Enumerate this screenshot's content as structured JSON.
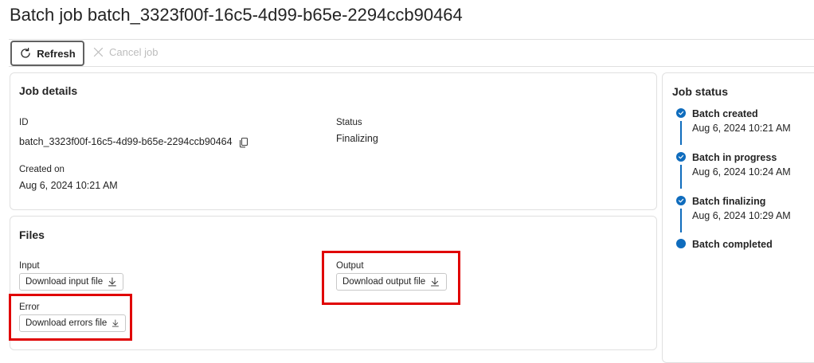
{
  "page": {
    "title": "Batch job batch_3323f00f-16c5-4d99-b65e-2294ccb90464"
  },
  "toolbar": {
    "refresh_label": "Refresh",
    "cancel_label": "Cancel job",
    "refresh_icon": "refresh-icon",
    "cancel_icon": "close-icon"
  },
  "job_details": {
    "title": "Job details",
    "id_label": "ID",
    "id_value": "batch_3323f00f-16c5-4d99-b65e-2294ccb90464",
    "status_label": "Status",
    "status_value": "Finalizing",
    "created_label": "Created on",
    "created_value": "Aug 6, 2024 10:21 AM",
    "copy_icon": "copy-icon"
  },
  "files": {
    "title": "Files",
    "input_label": "Input",
    "input_button": "Download input file",
    "output_label": "Output",
    "output_button": "Download output file",
    "error_label": "Error",
    "error_button": "Download errors file",
    "download_icon": "download-icon"
  },
  "job_status": {
    "title": "Job status",
    "steps": [
      {
        "label": "Batch created",
        "time": "Aug 6, 2024 10:21 AM",
        "state": "done"
      },
      {
        "label": "Batch in progress",
        "time": "Aug 6, 2024 10:24 AM",
        "state": "done"
      },
      {
        "label": "Batch finalizing",
        "time": "Aug 6, 2024 10:29 AM",
        "state": "done"
      },
      {
        "label": "Batch completed",
        "time": "",
        "state": "current"
      }
    ]
  },
  "colors": {
    "accent": "#0f6cbd",
    "highlight": "#e00000",
    "disabled": "#bdbdbd"
  }
}
